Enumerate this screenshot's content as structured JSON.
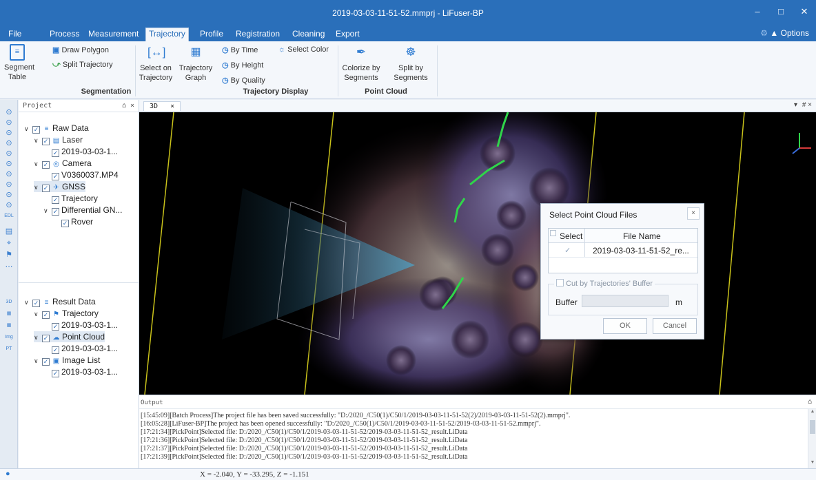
{
  "window": {
    "title": "2019-03-03-11-51-52.mmprj - LiFuser-BP",
    "minimize": "–",
    "maximize": "□",
    "close": "✕"
  },
  "menu": {
    "items": [
      "File",
      "Process",
      "Measurement",
      "Trajectory",
      "Profile",
      "Registration",
      "Cleaning",
      "Export"
    ],
    "active": "Trajectory",
    "options": "Options"
  },
  "ribbon": {
    "segmentation": {
      "segment_table": [
        "Segment",
        "Table"
      ],
      "draw_polygon": "Draw Polygon",
      "split_trajectory": "Split Trajectory",
      "label": "Segmentation"
    },
    "select_on_trajectory": [
      "Select on",
      "Trajectory"
    ],
    "trajectory_graph": [
      "Trajectory",
      "Graph"
    ],
    "trajectory_display": {
      "by_time": "By Time",
      "by_height": "By Height",
      "by_quality": "By Quality",
      "select_color": "Select Color",
      "label": "Trajectory Display"
    },
    "point_cloud": {
      "colorize": [
        "Colorize by",
        "Segments"
      ],
      "split": [
        "Split by",
        "Segments"
      ],
      "label": "Point Cloud"
    }
  },
  "project_panel": {
    "header": "Project",
    "raw_tree": [
      {
        "label": "Raw Data",
        "level": 0,
        "caret": true,
        "icon": "layers-icon",
        "glyph": "≡",
        "checked": true
      },
      {
        "label": "Laser",
        "level": 1,
        "caret": true,
        "icon": "laser-icon",
        "glyph": "▤",
        "checked": true
      },
      {
        "label": "2019-03-03-1...",
        "level": 2,
        "caret": false,
        "icon": "",
        "glyph": "",
        "checked": true
      },
      {
        "label": "Camera",
        "level": 1,
        "caret": true,
        "icon": "camera-icon",
        "glyph": "◎",
        "checked": true
      },
      {
        "label": "V0360037.MP4",
        "level": 2,
        "caret": false,
        "icon": "",
        "glyph": "",
        "checked": true
      },
      {
        "label": "GNSS",
        "level": 1,
        "caret": true,
        "icon": "gnss-icon",
        "glyph": "✈",
        "checked": true,
        "selected": true
      },
      {
        "label": "Trajectory",
        "level": 2,
        "caret": false,
        "icon": "",
        "glyph": "",
        "checked": true
      },
      {
        "label": "Differential GN...",
        "level": 2,
        "caret": true,
        "icon": "",
        "glyph": "",
        "checked": true
      },
      {
        "label": "Rover",
        "level": 3,
        "caret": false,
        "icon": "",
        "glyph": "",
        "checked": true
      }
    ],
    "result_tree": [
      {
        "label": "Result Data",
        "level": 0,
        "caret": true,
        "icon": "layers-icon",
        "glyph": "≡",
        "checked": true
      },
      {
        "label": "Trajectory",
        "level": 1,
        "caret": true,
        "icon": "trajectory-icon",
        "glyph": "⚑",
        "checked": true
      },
      {
        "label": "2019-03-03-1...",
        "level": 2,
        "caret": false,
        "icon": "",
        "glyph": "",
        "checked": true
      },
      {
        "label": "Point Cloud",
        "level": 1,
        "caret": true,
        "icon": "point-cloud-icon",
        "glyph": "☁",
        "checked": true,
        "selected": true
      },
      {
        "label": "2019-03-03-1...",
        "level": 2,
        "caret": false,
        "icon": "",
        "glyph": "",
        "checked": true
      },
      {
        "label": "Image List",
        "level": 1,
        "caret": true,
        "icon": "image-list-icon",
        "glyph": "▣",
        "checked": true
      },
      {
        "label": "2019-03-03-1...",
        "level": 2,
        "caret": false,
        "icon": "",
        "glyph": "",
        "checked": true
      }
    ]
  },
  "icon_strip": {
    "top": [
      "⊙",
      "⊙",
      "⊙",
      "⊙",
      "⊙",
      "⊙",
      "⊙",
      "⊙",
      "⊙",
      "⊙"
    ],
    "edl": "EDL",
    "mid": [
      "▤",
      "⌖",
      "⚑",
      "⋯"
    ],
    "bottom": [
      "3D",
      "▦",
      "▦",
      "Img",
      "PT"
    ]
  },
  "view": {
    "tab": "3D",
    "tab_close": "×",
    "controls": "▾   # ×"
  },
  "dialog": {
    "title": "Select Point Cloud Files",
    "close": "×",
    "col_select": "Select",
    "col_file": "File Name",
    "rows": [
      {
        "checked": true,
        "name": "2019-03-03-11-51-52_re..."
      }
    ],
    "cut_by_buffer": "Cut by Trajectories' Buffer",
    "buffer_label": "Buffer",
    "buffer_value": "",
    "buffer_unit": "m",
    "ok": "OK",
    "cancel": "Cancel"
  },
  "output": {
    "header": "Output",
    "lines": [
      "[15:45:09][Batch Process]The project file has been saved successfully: \"D:/2020_/C50(1)/C50/1/2019-03-03-11-51-52(2)/2019-03-03-11-51-52(2).mmprj\".",
      "[16:05:28][LiFuser-BP]The project has been opened successfully: \"D:/2020_/C50(1)/C50/1/2019-03-03-11-51-52/2019-03-03-11-51-52.mmprj\".",
      "[17:21:34][PickPoint]Selected file: D:/2020_/C50(1)/C50/1/2019-03-03-11-51-52/2019-03-03-11-51-52_result.LiData",
      "[17:21:36][PickPoint]Selected file: D:/2020_/C50(1)/C50/1/2019-03-03-11-51-52/2019-03-03-11-51-52_result.LiData",
      "[17:21:37][PickPoint]Selected file: D:/2020_/C50(1)/C50/1/2019-03-03-11-51-52/2019-03-03-11-51-52_result.LiData",
      "[17:21:39][PickPoint]Selected file: D:/2020_/C50(1)/C50/1/2019-03-03-11-51-52/2019-03-03-11-51-52_result.LiData"
    ]
  },
  "status": {
    "coords": "X = -2.040, Y = -33.295, Z = -1.151"
  }
}
